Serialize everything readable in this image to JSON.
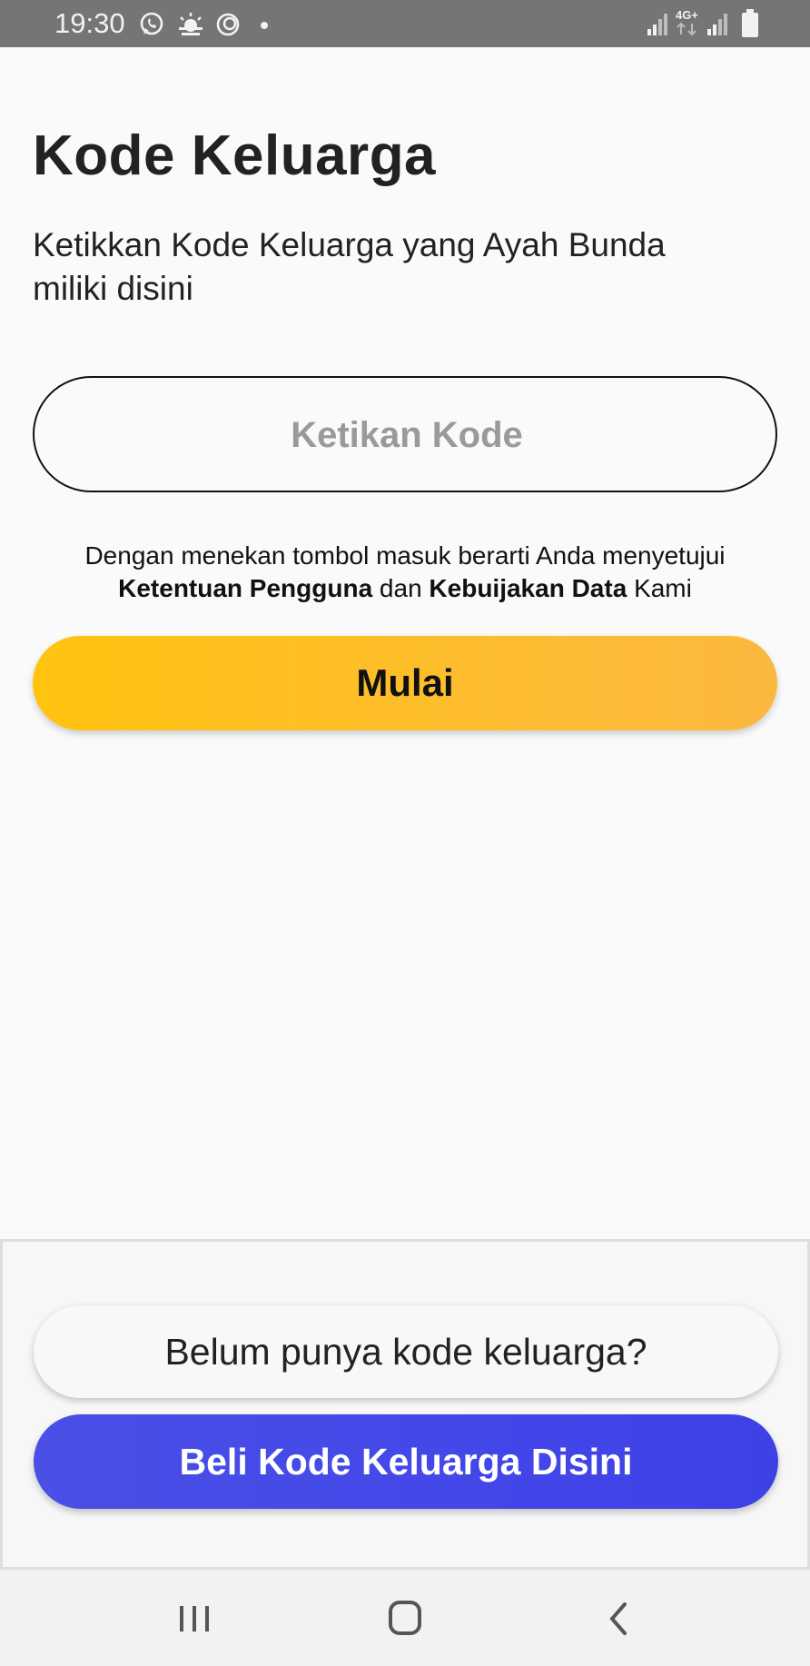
{
  "status_bar": {
    "time": "19:30",
    "left_icons": [
      "whatsapp-icon",
      "weather-icon",
      "sync-icon",
      "dot-icon"
    ],
    "right_icons": [
      "signal-icon",
      "4g-plus-icon",
      "signal-icon",
      "battery-icon"
    ],
    "network_label": "4G+"
  },
  "page": {
    "title": "Kode Keluarga",
    "subtitle": "Ketikkan Kode Keluarga yang Ayah Bunda\n miliki disini"
  },
  "code_input": {
    "value": "",
    "placeholder": "Ketikan Kode"
  },
  "terms": {
    "prefix": "Dengan menekan tombol masuk berarti Anda menyetujui",
    "terms_link": "Ketentuan Pengguna",
    "middle": "dan",
    "privacy_link": "Kebuijakan Data",
    "suffix": "Kami"
  },
  "start_button": {
    "label": "Mulai"
  },
  "bottom_panel": {
    "no_code_label": "Belum punya kode keluarga?",
    "buy_code_label": "Beli Kode Keluarga Disini"
  },
  "nav_bar": {
    "icons": [
      "recent-apps-icon",
      "home-icon",
      "back-icon"
    ]
  },
  "colors": {
    "accent_yellow": "#ffc310",
    "accent_blue": "#4347e8",
    "status_bar": "#757575",
    "background": "#fafafa"
  }
}
